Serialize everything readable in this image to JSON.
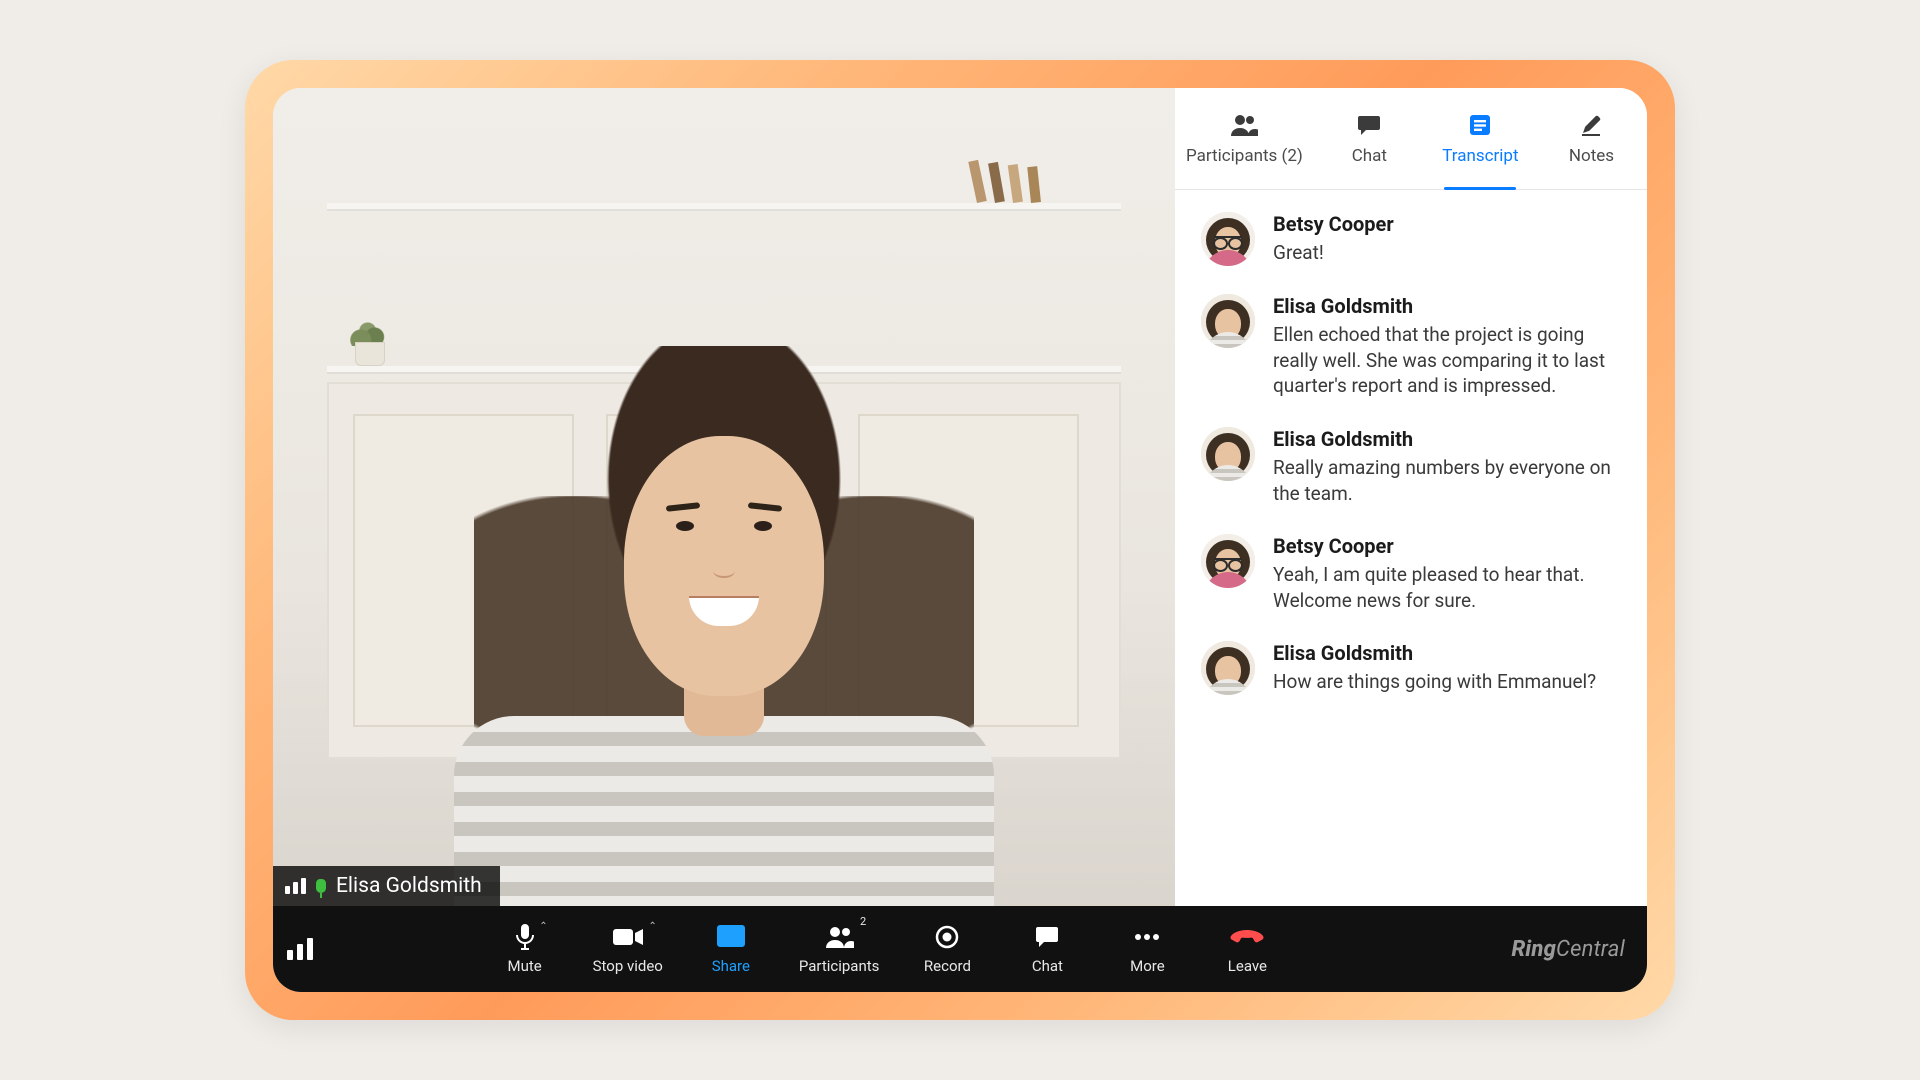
{
  "brand": {
    "name_bold": "Ring",
    "name_light": "Central"
  },
  "video": {
    "speaker_name": "Elisa Goldsmith"
  },
  "side_tabs": {
    "items": [
      {
        "id": "participants",
        "label": "Participants (2)",
        "active": false
      },
      {
        "id": "chat",
        "label": "Chat",
        "active": false
      },
      {
        "id": "transcript",
        "label": "Transcript",
        "active": true
      },
      {
        "id": "notes",
        "label": "Notes",
        "active": false
      }
    ]
  },
  "transcript": [
    {
      "speaker": "Betsy Cooper",
      "avatar_kind": "betsy",
      "text": "Great!"
    },
    {
      "speaker": "Elisa Goldsmith",
      "avatar_kind": "elisa",
      "text": "Ellen echoed that the project is going really well. She was comparing it to last quarter's report and is impressed."
    },
    {
      "speaker": "Elisa Goldsmith",
      "avatar_kind": "elisa",
      "text": "Really amazing numbers by everyone on the team."
    },
    {
      "speaker": "Betsy Cooper",
      "avatar_kind": "betsy",
      "text": "Yeah, I am quite pleased to hear that. Welcome news for sure."
    },
    {
      "speaker": "Elisa Goldsmith",
      "avatar_kind": "elisa",
      "text": "How are things going with Emmanuel?"
    }
  ],
  "toolbar": {
    "mute": "Mute",
    "stop_video": "Stop video",
    "share": "Share",
    "participants": "Participants",
    "participants_count": "2",
    "record": "Record",
    "chat": "Chat",
    "more": "More",
    "leave": "Leave"
  }
}
